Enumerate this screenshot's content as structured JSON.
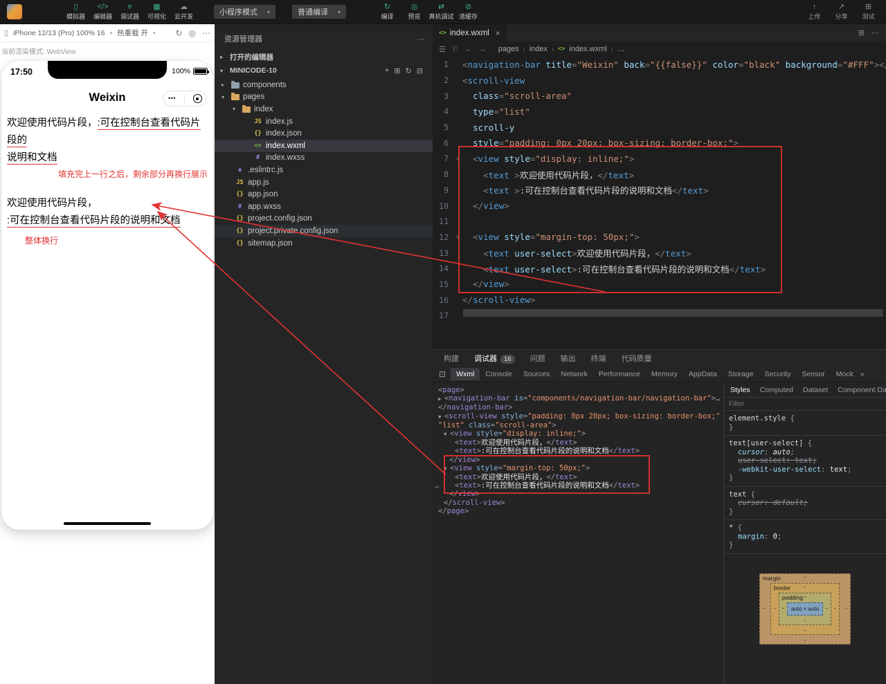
{
  "colors": {
    "annotation_red": "#e23333"
  },
  "topbar": {
    "mode_select": "小程序模式",
    "compile_select": "普通编译",
    "main_tools": [
      {
        "label": "模拟器",
        "icon": "simulator-icon",
        "glyph": "▯"
      },
      {
        "label": "编辑器",
        "icon": "editor-icon",
        "glyph": "</>"
      },
      {
        "label": "调试器",
        "icon": "debugger-icon",
        "glyph": "≡"
      },
      {
        "label": "可视化",
        "icon": "visualizer-icon",
        "glyph": "▦"
      },
      {
        "label": "云开发",
        "icon": "cloud-dev-icon",
        "glyph": "☁",
        "grey": true
      }
    ],
    "action_tools": [
      {
        "label": "编译",
        "icon": "compile-icon",
        "glyph": "↻"
      },
      {
        "label": "预览",
        "icon": "preview-icon",
        "glyph": "◎"
      },
      {
        "label": "真机调试",
        "icon": "remote-debug-icon",
        "glyph": "⇄"
      },
      {
        "label": "清缓存",
        "icon": "clear-cache-icon",
        "glyph": "⊘"
      }
    ],
    "right_tools": [
      {
        "label": "上传",
        "icon": "upload-icon",
        "glyph": "↑"
      },
      {
        "label": "分享",
        "icon": "share-icon",
        "glyph": "↗"
      },
      {
        "label": "测试",
        "icon": "test-icon",
        "glyph": "⊞"
      }
    ]
  },
  "simulator": {
    "device_label": "iPhone 12/13 (Pro) 100% 16",
    "hot_reload_label": "热重载 开",
    "render_mode": "当前渲染模式: WebView",
    "phone": {
      "time": "17:50",
      "battery": "100%",
      "nav_title": "Weixin",
      "menu_dots": "•••",
      "block1_normal": "欢迎使用代码片段，",
      "block1_underline_1": ":可在控制台查看代码片段的",
      "block1_underline_2": "说明和文档",
      "annotation1": "填充完上一行之后，剩余部分再换行展示",
      "block2_line1": "欢迎使用代码片段，",
      "block2_line2": ":可在控制台查看代码片段的说明和文档",
      "annotation2": "整体换行"
    }
  },
  "explorer": {
    "title": "资源管理器",
    "more": "⋯",
    "open_editors_label": "打开的编辑器",
    "project_name": "MINICODE-10",
    "project_actions": [
      {
        "icon": "new-file-icon",
        "glyph": "+"
      },
      {
        "icon": "new-folder-icon",
        "glyph": "⊞"
      },
      {
        "icon": "refresh-icon",
        "glyph": "↻"
      },
      {
        "icon": "collapse-all-icon",
        "glyph": "⊟"
      }
    ],
    "tree": [
      {
        "label": "components",
        "type": "folder",
        "chevron": "▸",
        "level": 0,
        "color": "#8fa1ad"
      },
      {
        "label": "pages",
        "type": "folder",
        "chevron": "▾",
        "level": 0,
        "color": "#d7a65f"
      },
      {
        "label": "index",
        "type": "folder",
        "chevron": "▾",
        "level": 1,
        "color": "#d7a65f"
      },
      {
        "label": "index.js",
        "type": "js",
        "level": 2
      },
      {
        "label": "index.json",
        "type": "json",
        "level": 2
      },
      {
        "label": "index.wxml",
        "type": "wxml",
        "level": 2,
        "selected": true
      },
      {
        "label": "index.wxss",
        "type": "wxss",
        "level": 2
      },
      {
        "label": ".eslintrc.js",
        "type": "eslint",
        "level": 0
      },
      {
        "label": "app.js",
        "type": "js",
        "level": 0
      },
      {
        "label": "app.json",
        "type": "json",
        "level": 0
      },
      {
        "label": "app.wxss",
        "type": "wxss",
        "level": 0
      },
      {
        "label": "project.config.json",
        "type": "json",
        "level": 0
      },
      {
        "label": "project.private.config.json",
        "type": "json",
        "level": 0,
        "highlight": true
      },
      {
        "label": "sitemap.json",
        "type": "json",
        "level": 0
      }
    ]
  },
  "editor": {
    "tab_label": "index.wxml",
    "close_glyph": "×",
    "breadcrumb": [
      "pages",
      "index",
      "index.wxml",
      "…"
    ],
    "lines": [
      {
        "n": 1,
        "t": [
          [
            "p",
            "<"
          ],
          [
            "t",
            "navigation-bar"
          ],
          [
            "a",
            " title"
          ],
          [
            "p",
            "="
          ],
          [
            "s",
            "\"Weixin\""
          ],
          [
            "a",
            " back"
          ],
          [
            "p",
            "="
          ],
          [
            "s",
            "\"{{false}}\""
          ],
          [
            "a",
            " color"
          ],
          [
            "p",
            "="
          ],
          [
            "s",
            "\"black\""
          ],
          [
            "a",
            " background"
          ],
          [
            "p",
            "="
          ],
          [
            "s",
            "\"#FFF\""
          ],
          [
            "p",
            "></"
          ],
          [
            "t",
            "navigation-bar"
          ],
          [
            "p",
            ">"
          ]
        ]
      },
      {
        "n": 2,
        "t": [
          [
            "p",
            "<"
          ],
          [
            "t",
            "scroll-view"
          ]
        ]
      },
      {
        "n": 3,
        "t": [
          [
            "x",
            "  "
          ],
          [
            "a",
            "class"
          ],
          [
            "p",
            "="
          ],
          [
            "s",
            "\"scroll-area\""
          ]
        ]
      },
      {
        "n": 4,
        "t": [
          [
            "x",
            "  "
          ],
          [
            "a",
            "type"
          ],
          [
            "p",
            "="
          ],
          [
            "s",
            "\"list\""
          ]
        ]
      },
      {
        "n": 5,
        "t": [
          [
            "x",
            "  "
          ],
          [
            "a",
            "scroll-y"
          ]
        ]
      },
      {
        "n": 6,
        "t": [
          [
            "x",
            "  "
          ],
          [
            "a",
            "style"
          ],
          [
            "p",
            "="
          ],
          [
            "s",
            "\"padding: 0px 20px; box-sizing: border-box;\""
          ],
          [
            "p",
            ">"
          ]
        ]
      },
      {
        "n": 7,
        "fold": true,
        "t": [
          [
            "x",
            "  "
          ],
          [
            "p",
            "<"
          ],
          [
            "t",
            "view"
          ],
          [
            "a",
            " style"
          ],
          [
            "p",
            "="
          ],
          [
            "s",
            "\"display: inline;\""
          ],
          [
            "p",
            ">"
          ]
        ]
      },
      {
        "n": 8,
        "t": [
          [
            "x",
            "    "
          ],
          [
            "p",
            "<"
          ],
          [
            "t",
            "text"
          ],
          [
            "p",
            " >"
          ],
          [
            "x",
            "欢迎使用代码片段，"
          ],
          [
            "p",
            "</"
          ],
          [
            "t",
            "text"
          ],
          [
            "p",
            ">"
          ]
        ]
      },
      {
        "n": 9,
        "t": [
          [
            "x",
            "    "
          ],
          [
            "p",
            "<"
          ],
          [
            "t",
            "text"
          ],
          [
            "p",
            " >"
          ],
          [
            "x",
            ":可在控制台查看代码片段的说明和文档"
          ],
          [
            "p",
            "</"
          ],
          [
            "t",
            "text"
          ],
          [
            "p",
            ">"
          ]
        ]
      },
      {
        "n": 10,
        "t": [
          [
            "x",
            "  "
          ],
          [
            "p",
            "</"
          ],
          [
            "t",
            "view"
          ],
          [
            "p",
            ">"
          ]
        ]
      },
      {
        "n": 11,
        "t": []
      },
      {
        "n": 12,
        "fold": true,
        "t": [
          [
            "x",
            "  "
          ],
          [
            "p",
            "<"
          ],
          [
            "t",
            "view"
          ],
          [
            "a",
            " style"
          ],
          [
            "p",
            "="
          ],
          [
            "s",
            "\"margin-top: 50px;\""
          ],
          [
            "p",
            ">"
          ]
        ]
      },
      {
        "n": 13,
        "t": [
          [
            "x",
            "    "
          ],
          [
            "p",
            "<"
          ],
          [
            "t",
            "text"
          ],
          [
            "a",
            " user-select"
          ],
          [
            "p",
            ">"
          ],
          [
            "x",
            "欢迎使用代码片段，"
          ],
          [
            "p",
            "</"
          ],
          [
            "t",
            "text"
          ],
          [
            "p",
            ">"
          ]
        ]
      },
      {
        "n": 14,
        "t": [
          [
            "x",
            "    "
          ],
          [
            "p",
            "<"
          ],
          [
            "t",
            "text"
          ],
          [
            "a",
            " user-select"
          ],
          [
            "p",
            ">"
          ],
          [
            "x",
            ":可在控制台查看代码片段的说明和文档"
          ],
          [
            "p",
            "</"
          ],
          [
            "t",
            "text"
          ],
          [
            "p",
            ">"
          ]
        ]
      },
      {
        "n": 15,
        "t": [
          [
            "x",
            "  "
          ],
          [
            "p",
            "</"
          ],
          [
            "t",
            "view"
          ],
          [
            "p",
            ">"
          ]
        ]
      },
      {
        "n": 16,
        "t": [
          [
            "p",
            "</"
          ],
          [
            "t",
            "scroll-view"
          ],
          [
            "p",
            ">"
          ]
        ]
      },
      {
        "n": 17,
        "t": []
      }
    ]
  },
  "devtools": {
    "panel_tabs": [
      {
        "label": "构建"
      },
      {
        "label": "调试器",
        "badge": "16",
        "active": true
      },
      {
        "label": "问题"
      },
      {
        "label": "输出"
      },
      {
        "label": "终端"
      },
      {
        "label": "代码质量"
      }
    ],
    "tabs": [
      "Wxml",
      "Console",
      "Sources",
      "Network",
      "Performance",
      "Memory",
      "AppData",
      "Storage",
      "Security",
      "Sensor",
      "Mock"
    ],
    "active_tab": "Wxml",
    "overflow_chevron": "»",
    "tree": [
      {
        "tokens": [
          [
            "p",
            "<"
          ],
          [
            "t",
            "page"
          ],
          [
            "p",
            ">"
          ]
        ]
      },
      {
        "arrow": "▶",
        "tokens": [
          [
            "p",
            "<"
          ],
          [
            "t",
            "navigation-bar"
          ],
          [
            "a",
            " is"
          ],
          [
            "p",
            "="
          ],
          [
            "s",
            "\"components/navigation-bar/navigation-bar\""
          ],
          [
            "p",
            ">"
          ],
          [
            "p",
            "…"
          ]
        ]
      },
      {
        "tokens": [
          [
            "p",
            "</"
          ],
          [
            "t",
            "navigation-bar"
          ],
          [
            "p",
            ">"
          ]
        ]
      },
      {
        "arrow": "▼",
        "tokens": [
          [
            "p",
            "<"
          ],
          [
            "t",
            "scroll-view"
          ],
          [
            "a",
            " style"
          ],
          [
            "p",
            "="
          ],
          [
            "s",
            "\"padding: 0px 20px; box-sizing: border-box;\""
          ],
          [
            "a",
            " type"
          ],
          [
            "p",
            "="
          ]
        ]
      },
      {
        "tokens": [
          [
            "s",
            "\"list\""
          ],
          [
            "a",
            " class"
          ],
          [
            "p",
            "="
          ],
          [
            "s",
            "\"scroll-area\""
          ],
          [
            "p",
            ">"
          ]
        ]
      },
      {
        "ind": 1,
        "arrow": "▼",
        "tokens": [
          [
            "p",
            "<"
          ],
          [
            "t",
            "view"
          ],
          [
            "a",
            " style"
          ],
          [
            "p",
            "="
          ],
          [
            "s",
            "\"display: inline;\""
          ],
          [
            "p",
            ">"
          ]
        ]
      },
      {
        "ind": 3,
        "tokens": [
          [
            "p",
            "<"
          ],
          [
            "t",
            "text"
          ],
          [
            "p",
            ">"
          ],
          [
            "x",
            "欢迎使用代码片段，"
          ],
          [
            "p",
            "</"
          ],
          [
            "t",
            "text"
          ],
          [
            "p",
            ">"
          ]
        ]
      },
      {
        "ind": 3,
        "tokens": [
          [
            "p",
            "<"
          ],
          [
            "t",
            "text"
          ],
          [
            "p",
            ">"
          ],
          [
            "x",
            ":可在控制台查看代码片段的说明和文档"
          ],
          [
            "p",
            "</"
          ],
          [
            "t",
            "text"
          ],
          [
            "p",
            ">"
          ]
        ]
      },
      {
        "ind": 2,
        "tokens": [
          [
            "p",
            "</"
          ],
          [
            "t",
            "view"
          ],
          [
            "p",
            ">"
          ]
        ]
      },
      {
        "ind": 1,
        "arrow": "▼",
        "tokens": [
          [
            "p",
            "<"
          ],
          [
            "t",
            "view"
          ],
          [
            "a",
            " style"
          ],
          [
            "p",
            "="
          ],
          [
            "s",
            "\"margin-top: 50px;\""
          ],
          [
            "p",
            ">"
          ]
        ]
      },
      {
        "ind": 3,
        "tokens": [
          [
            "p",
            "<"
          ],
          [
            "t",
            "text"
          ],
          [
            "p",
            ">"
          ],
          [
            "x",
            "欢迎使用代码片段，"
          ],
          [
            "p",
            "</"
          ],
          [
            "t",
            "text"
          ],
          [
            "p",
            ">"
          ]
        ]
      },
      {
        "ind": 3,
        "ellipsis": true,
        "tokens": [
          [
            "p",
            "<"
          ],
          [
            "t",
            "text"
          ],
          [
            "p",
            ">"
          ],
          [
            "x",
            ":可在控制台查看代码片段的说明和文档"
          ],
          [
            "p",
            "</"
          ],
          [
            "t",
            "text"
          ],
          [
            "p",
            ">"
          ]
        ]
      },
      {
        "ind": 2,
        "tokens": [
          [
            "p",
            "</"
          ],
          [
            "t",
            "view"
          ],
          [
            "p",
            ">"
          ]
        ]
      },
      {
        "ind": 1,
        "tokens": [
          [
            "p",
            "</"
          ],
          [
            "t",
            "scroll-view"
          ],
          [
            "p",
            ">"
          ]
        ]
      },
      {
        "tokens": [
          [
            "p",
            "</"
          ],
          [
            "t",
            "page"
          ],
          [
            "p",
            ">"
          ]
        ]
      }
    ]
  },
  "styles_panel": {
    "tabs": [
      "Styles",
      "Computed",
      "Dataset",
      "Component Data"
    ],
    "active_tab": "Styles",
    "filter_placeholder": "Filter",
    "rules": [
      {
        "selector": "element.style",
        "props": []
      },
      {
        "selector": "text[user-select]",
        "props": [
          {
            "name": "cursor",
            "value": "auto",
            "italic": true
          },
          {
            "name": "user-select",
            "value": "text",
            "struck": true
          },
          {
            "name": "-webkit-user-select",
            "value": "text"
          }
        ]
      },
      {
        "selector": "text",
        "props": [
          {
            "name": "cursor",
            "value": "default",
            "struck": true,
            "italic": true
          }
        ]
      },
      {
        "selector": "*",
        "props": [
          {
            "name": "margin",
            "value": "0"
          }
        ]
      }
    ],
    "box_model": {
      "rings": [
        "margin",
        "border",
        "padding"
      ],
      "content": "auto × auto",
      "dash": "-"
    }
  }
}
